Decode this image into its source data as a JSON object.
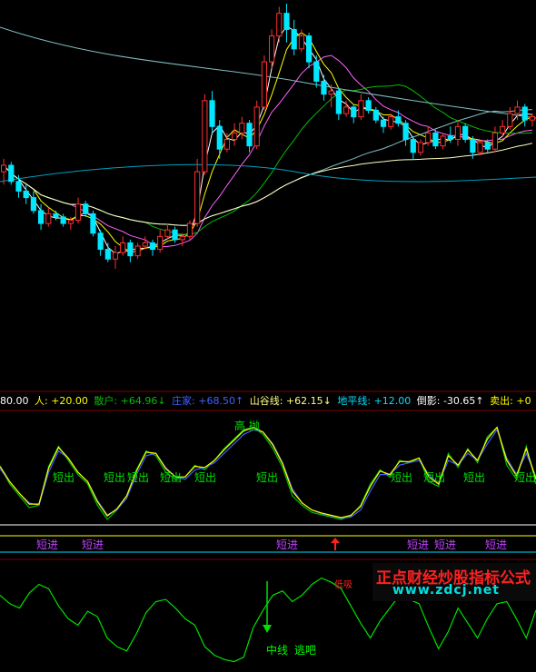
{
  "legend": [
    {
      "text": "80.00",
      "color": "#ffffff",
      "name": "legend-value"
    },
    {
      "text": "人: +20.00",
      "color": "#ffff00",
      "name": "legend-ren"
    },
    {
      "text": "散户: +64.96↓",
      "color": "#00c000",
      "name": "legend-sanhu"
    },
    {
      "text": "庄家: +68.50↑",
      "color": "#4060ff",
      "name": "legend-zhuangjia"
    },
    {
      "text": "山谷线: +62.15↓",
      "color": "#ffff80",
      "name": "legend-shanguxian"
    },
    {
      "text": "地平线: +12.00",
      "color": "#00e0ff",
      "name": "legend-dipingxian"
    },
    {
      "text": "倒影: -30.65↑",
      "color": "#ffffff",
      "name": "legend-daoying"
    },
    {
      "text": "卖出: +0",
      "color": "#ffff00",
      "name": "legend-maichu"
    }
  ],
  "colors": {
    "up": "#ff3030",
    "down": "#00e8ff",
    "ma_white": "#ffffff",
    "ma_yellow": "#ffff00",
    "ma_magenta": "#ff60ff",
    "ma_green": "#00c000",
    "ma_teal": "#80c0c0",
    "ma_cream": "#ffffc0",
    "ma_cyan": "#00a0c0"
  },
  "annotations": {
    "duanchu": "短出",
    "duanjin": "短进",
    "gaopao": "高 抛",
    "zhongxian": "中线",
    "taoba": "逃吧",
    "diyi": "低吸"
  },
  "watermark": {
    "title": "正点财经炒股指标公式",
    "url": "www.zdcj.net"
  },
  "chart_data": [
    {
      "type": "candlestick",
      "title": "",
      "xlabel": "",
      "ylabel": "",
      "price_range": [
        0,
        100
      ],
      "candles": [
        [
          48,
          52,
          44,
          50
        ],
        [
          50,
          51,
          44,
          45
        ],
        [
          45,
          47,
          40,
          42
        ],
        [
          42,
          44,
          38,
          40
        ],
        [
          40,
          42,
          35,
          36
        ],
        [
          36,
          38,
          30,
          32
        ],
        [
          32,
          37,
          31,
          35
        ],
        [
          35,
          36,
          33,
          34
        ],
        [
          34,
          35,
          31,
          32
        ],
        [
          32,
          34,
          30,
          33
        ],
        [
          33,
          40,
          32,
          38
        ],
        [
          38,
          39,
          34,
          35
        ],
        [
          35,
          36,
          28,
          29
        ],
        [
          29,
          30,
          22,
          24
        ],
        [
          24,
          26,
          20,
          21
        ],
        [
          21,
          25,
          18,
          23
        ],
        [
          23,
          28,
          22,
          26
        ],
        [
          26,
          27,
          20,
          22
        ],
        [
          22,
          26,
          21,
          25
        ],
        [
          25,
          28,
          24,
          26
        ],
        [
          26,
          27,
          22,
          24
        ],
        [
          24,
          30,
          23,
          28
        ],
        [
          28,
          32,
          27,
          30
        ],
        [
          30,
          31,
          26,
          27
        ],
        [
          27,
          29,
          25,
          28
        ],
        [
          28,
          33,
          27,
          32
        ],
        [
          32,
          52,
          31,
          48
        ],
        [
          48,
          72,
          47,
          70
        ],
        [
          70,
          73,
          60,
          62
        ],
        [
          62,
          64,
          52,
          55
        ],
        [
          55,
          60,
          54,
          58
        ],
        [
          58,
          63,
          56,
          60
        ],
        [
          60,
          65,
          58,
          63
        ],
        [
          63,
          64,
          54,
          56
        ],
        [
          56,
          70,
          55,
          68
        ],
        [
          68,
          84,
          67,
          82
        ],
        [
          82,
          92,
          80,
          90
        ],
        [
          90,
          99,
          88,
          97
        ],
        [
          97,
          100,
          88,
          92
        ],
        [
          92,
          95,
          84,
          86
        ],
        [
          86,
          92,
          85,
          90
        ],
        [
          90,
          91,
          80,
          82
        ],
        [
          82,
          84,
          74,
          76
        ],
        [
          76,
          78,
          70,
          72
        ],
        [
          72,
          75,
          68,
          73
        ],
        [
          73,
          74,
          64,
          66
        ],
        [
          66,
          70,
          65,
          68
        ],
        [
          68,
          69,
          63,
          65
        ],
        [
          65,
          72,
          64,
          70
        ],
        [
          70,
          71,
          66,
          67
        ],
        [
          67,
          68,
          63,
          64
        ],
        [
          64,
          65,
          60,
          62
        ],
        [
          62,
          66,
          61,
          65
        ],
        [
          65,
          67,
          62,
          63
        ],
        [
          63,
          64,
          56,
          58
        ],
        [
          58,
          59,
          52,
          54
        ],
        [
          54,
          58,
          53,
          57
        ],
        [
          57,
          62,
          56,
          60
        ],
        [
          60,
          61,
          55,
          56
        ],
        [
          56,
          60,
          55,
          59
        ],
        [
          59,
          62,
          57,
          58
        ],
        [
          58,
          64,
          56,
          62
        ],
        [
          62,
          63,
          57,
          58
        ],
        [
          58,
          59,
          52,
          54
        ],
        [
          54,
          58,
          53,
          57
        ],
        [
          57,
          58,
          54,
          55
        ],
        [
          55,
          62,
          54,
          60
        ],
        [
          60,
          64,
          59,
          62
        ],
        [
          62,
          68,
          61,
          66
        ],
        [
          66,
          70,
          64,
          68
        ],
        [
          68,
          69,
          62,
          64
        ],
        [
          64,
          66,
          62,
          65
        ]
      ]
    },
    {
      "type": "line",
      "title": "",
      "ylim": [
        0,
        100
      ],
      "series": [
        {
          "name": "散户",
          "values": [
            55,
            40,
            30,
            20,
            22,
            55,
            72,
            60,
            48,
            40,
            22,
            10,
            18,
            30,
            52,
            68,
            64,
            50,
            44,
            46,
            56,
            52,
            60,
            70,
            78,
            86,
            88,
            82,
            70,
            54,
            30,
            22,
            16,
            14,
            12,
            10,
            13,
            22,
            40,
            52,
            46,
            60,
            58,
            62,
            42,
            38,
            66,
            54,
            70,
            58,
            80,
            88,
            56,
            44,
            72,
            40
          ]
        },
        {
          "name": "庄家",
          "values": [
            53,
            42,
            32,
            24,
            22,
            50,
            68,
            62,
            50,
            42,
            26,
            14,
            18,
            28,
            48,
            64,
            66,
            54,
            46,
            44,
            52,
            54,
            58,
            66,
            74,
            82,
            86,
            84,
            74,
            58,
            36,
            24,
            18,
            15,
            13,
            11,
            12,
            18,
            34,
            48,
            48,
            56,
            58,
            60,
            48,
            40,
            60,
            56,
            66,
            60,
            74,
            86,
            62,
            48,
            66,
            46
          ]
        }
      ]
    },
    {
      "type": "line",
      "title": "",
      "ylim": [
        0,
        100
      ],
      "series": [
        {
          "name": "倒影",
          "values": [
            70,
            62,
            58,
            72,
            80,
            76,
            60,
            48,
            42,
            55,
            50,
            30,
            22,
            18,
            34,
            54,
            64,
            66,
            58,
            48,
            42,
            22,
            14,
            10,
            8,
            12,
            40,
            56,
            70,
            74,
            64,
            70,
            80,
            86,
            82,
            76,
            60,
            44,
            30,
            46,
            58,
            70,
            66,
            62,
            40,
            20,
            36,
            58,
            44,
            30,
            48,
            62,
            64,
            48,
            30,
            56
          ]
        }
      ]
    }
  ]
}
